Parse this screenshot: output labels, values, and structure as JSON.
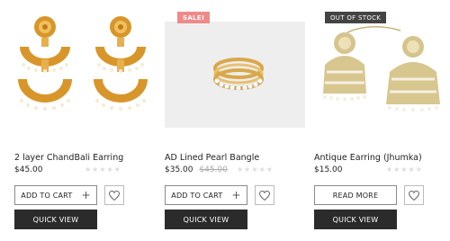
{
  "products": [
    {
      "title": "2 layer ChandBali Earring",
      "price": "$45.00",
      "old_price": "",
      "badge": "",
      "rating_stars": "★★★★★",
      "primary_action": "ADD TO CART",
      "quick_view": "QUICK VIEW",
      "wishlist_icon": "heart-icon",
      "image_icon": "chandbali-earring-image"
    },
    {
      "title": "AD Lined Pearl Bangle",
      "price": "$35.00",
      "old_price": "$45.00",
      "badge": "SALE!",
      "rating_stars": "★★★★★",
      "primary_action": "ADD TO CART",
      "quick_view": "QUICK VIEW",
      "wishlist_icon": "heart-icon",
      "image_icon": "pearl-bangle-image"
    },
    {
      "title": "Antique Earring (Jhumka)",
      "price": "$15.00",
      "old_price": "",
      "badge": "OUT OF STOCK",
      "rating_stars": "★★★★★",
      "primary_action": "READ MORE",
      "quick_view": "QUICK VIEW",
      "wishlist_icon": "heart-icon",
      "image_icon": "jhumka-earring-image"
    }
  ],
  "colors": {
    "sale_badge": "#f08a8a",
    "out_of_stock_badge": "#444444",
    "quick_view_bg": "#2b2b2b",
    "star_empty": "#dcdcdc"
  }
}
